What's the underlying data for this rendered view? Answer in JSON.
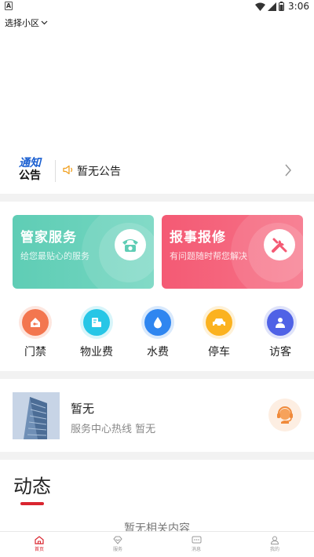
{
  "status_bar": {
    "left_badge": "A",
    "time": "3:06"
  },
  "header": {
    "community_selector": "选择小区"
  },
  "notice": {
    "logo_line1": "通知",
    "logo_line2": "公告",
    "text": "暂无公告"
  },
  "cards": {
    "housekeeper": {
      "title": "管家服务",
      "subtitle": "给您最贴心的服务"
    },
    "repair": {
      "title": "报事报修",
      "subtitle": "有问题随时帮您解决"
    }
  },
  "quick_actions": [
    {
      "label": "门禁",
      "icon": "door-key-icon",
      "color": "#f3764f"
    },
    {
      "label": "物业费",
      "icon": "bill-icon",
      "color": "#27c6e6"
    },
    {
      "label": "水费",
      "icon": "water-drop-icon",
      "color": "#2f86f0"
    },
    {
      "label": "停车",
      "icon": "car-icon",
      "color": "#fbb21f"
    },
    {
      "label": "访客",
      "icon": "visitor-icon",
      "color": "#4f62e6"
    }
  ],
  "hotline": {
    "title": "暂无",
    "subtitle": "服务中心热线 暂无"
  },
  "news": {
    "title": "动态",
    "empty": "暂无相关内容"
  },
  "bottom_nav": [
    {
      "label": "首页",
      "icon": "home-icon",
      "active": true
    },
    {
      "label": "服务",
      "icon": "service-icon",
      "active": false
    },
    {
      "label": "消息",
      "icon": "message-icon",
      "active": false
    },
    {
      "label": "我的",
      "icon": "profile-icon",
      "active": false
    }
  ],
  "colors": {
    "brand_red": "#d9252f",
    "card_green": "#5fcdb5",
    "card_red": "#f45a74",
    "notice_blue": "#1a5fd1"
  }
}
